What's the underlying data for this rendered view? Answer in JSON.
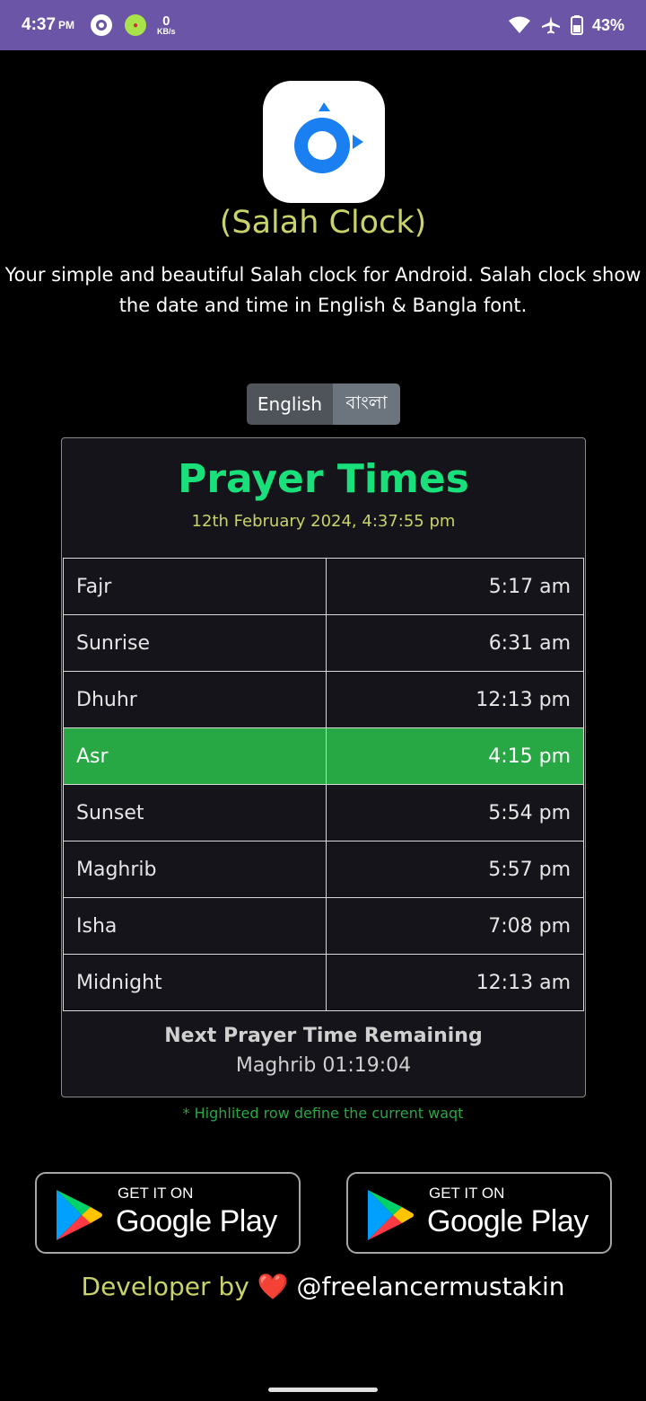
{
  "status_bar": {
    "time": "4:37",
    "ampm": "PM",
    "net_value": "0",
    "net_unit": "KB/s",
    "battery": "43%",
    "icons": [
      "app-circle-icon",
      "green-badge-icon",
      "wifi-icon",
      "airplane-icon",
      "battery-icon"
    ]
  },
  "app": {
    "title": "(Salah Clock)",
    "description": "Your simple and beautiful Salah clock for Android. Salah clock show the date and time in English & Bangla font.",
    "icon_color": "#1a7ff0"
  },
  "language": {
    "english": "English",
    "bangla": "বাংলা"
  },
  "prayer_card": {
    "title": "Prayer Times",
    "datetime": "12th February 2024, 4:37:55 pm",
    "rows": [
      {
        "name": "Fajr",
        "time": "5:17 am"
      },
      {
        "name": "Sunrise",
        "time": "6:31 am"
      },
      {
        "name": "Dhuhr",
        "time": "12:13 pm"
      },
      {
        "name": "Asr",
        "time": "4:15 pm"
      },
      {
        "name": "Sunset",
        "time": "5:54 pm"
      },
      {
        "name": "Maghrib",
        "time": "5:57 pm"
      },
      {
        "name": "Isha",
        "time": "7:08 pm"
      },
      {
        "name": "Midnight",
        "time": "12:13 am"
      }
    ],
    "current_row": "Asr",
    "next_title": "Next Prayer Time Remaining",
    "next_value": "Maghrib 01:19:04",
    "colors": {
      "title": "#19e07a",
      "current_row": "#28a745",
      "date": "#c9d36a"
    }
  },
  "hint": "* Highlited row define the current waqt",
  "store_buttons": [
    {
      "small": "GET IT ON",
      "big": "Google Play"
    },
    {
      "small": "GET IT ON",
      "big": "Google Play"
    }
  ],
  "developer": {
    "label": "Developer by",
    "heart": "❤️",
    "handle": "@freelancermustakin"
  }
}
